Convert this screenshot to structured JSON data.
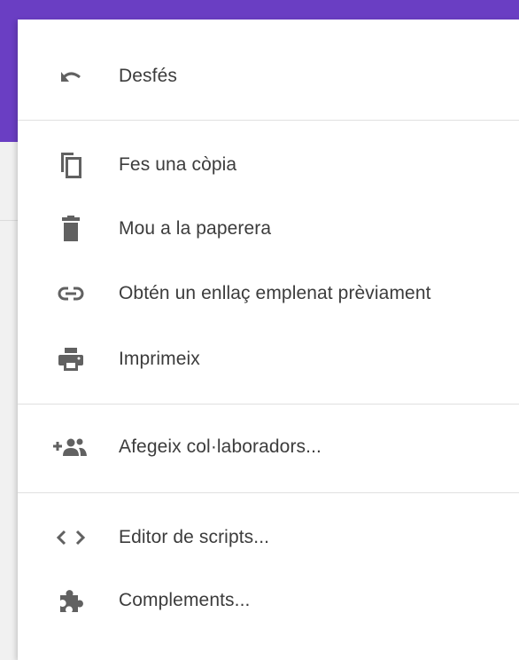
{
  "menu": {
    "items": [
      {
        "id": "undo",
        "label": "Desfés",
        "icon": "undo-icon"
      },
      {
        "id": "copy",
        "label": "Fes una còpia",
        "icon": "copy-icon"
      },
      {
        "id": "trash",
        "label": "Mou a la paperera",
        "icon": "trash-icon"
      },
      {
        "id": "prefilled-link",
        "label": "Obtén un enllaç emplenat prèviament",
        "icon": "link-icon"
      },
      {
        "id": "print",
        "label": "Imprimeix",
        "icon": "print-icon"
      },
      {
        "id": "collaborators",
        "label": "Afegeix col·laboradors...",
        "icon": "add-people-icon"
      },
      {
        "id": "script-editor",
        "label": "Editor de scripts...",
        "icon": "code-icon"
      },
      {
        "id": "addons",
        "label": "Complements...",
        "icon": "puzzle-icon"
      }
    ]
  },
  "colors": {
    "accent": "#6a3ec3",
    "icon": "#616161",
    "text": "#3c3c3c",
    "divider": "#e0e0e0"
  }
}
